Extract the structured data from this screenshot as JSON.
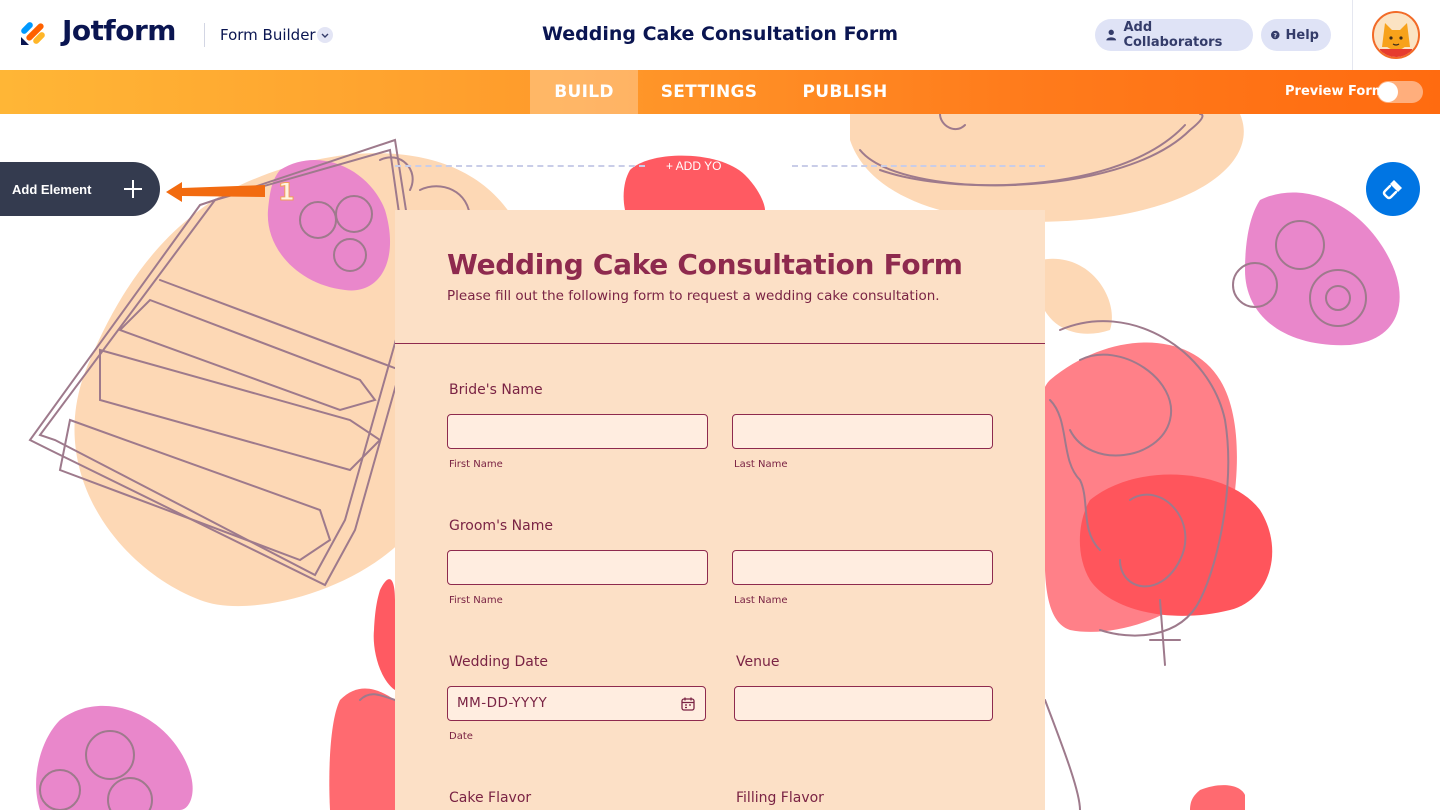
{
  "header": {
    "brand": "Jotform",
    "builder_label": "Form Builder",
    "form_title": "Wedding Cake Consultation Form",
    "collaborators_label": "Add Collaborators",
    "help_label": "Help"
  },
  "nav": {
    "tabs": [
      {
        "label": "BUILD",
        "active": true
      },
      {
        "label": "SETTINGS",
        "active": false
      },
      {
        "label": "PUBLISH",
        "active": false
      }
    ],
    "preview_label": "Preview Form",
    "preview_enabled": false
  },
  "canvas": {
    "add_element_label": "Add Element",
    "annotation_number": "1",
    "add_logo_text": "+ ADD YO"
  },
  "form": {
    "title": "Wedding Cake Consultation Form",
    "subtitle": "Please fill out the following form to request a wedding cake consultation.",
    "brides_name": {
      "label": "Bride's Name",
      "first": "First Name",
      "last": "Last Name",
      "first_value": "",
      "last_value": ""
    },
    "grooms_name": {
      "label": "Groom's Name",
      "first": "First Name",
      "last": "Last Name",
      "first_value": "",
      "last_value": ""
    },
    "wedding_date": {
      "label": "Wedding Date",
      "placeholder": "MM-DD-YYYY",
      "sub": "Date"
    },
    "venue": {
      "label": "Venue",
      "value": ""
    },
    "cake_flavor": {
      "label": "Cake Flavor"
    },
    "filling_flavor": {
      "label": "Filling Flavor"
    }
  },
  "colors": {
    "brand_navy": "#0a1551",
    "nav_orange": "#ff7c1c",
    "form_bg": "#fce0c6",
    "form_accent": "#8e2a4e",
    "designer_blue": "#0075e3"
  }
}
